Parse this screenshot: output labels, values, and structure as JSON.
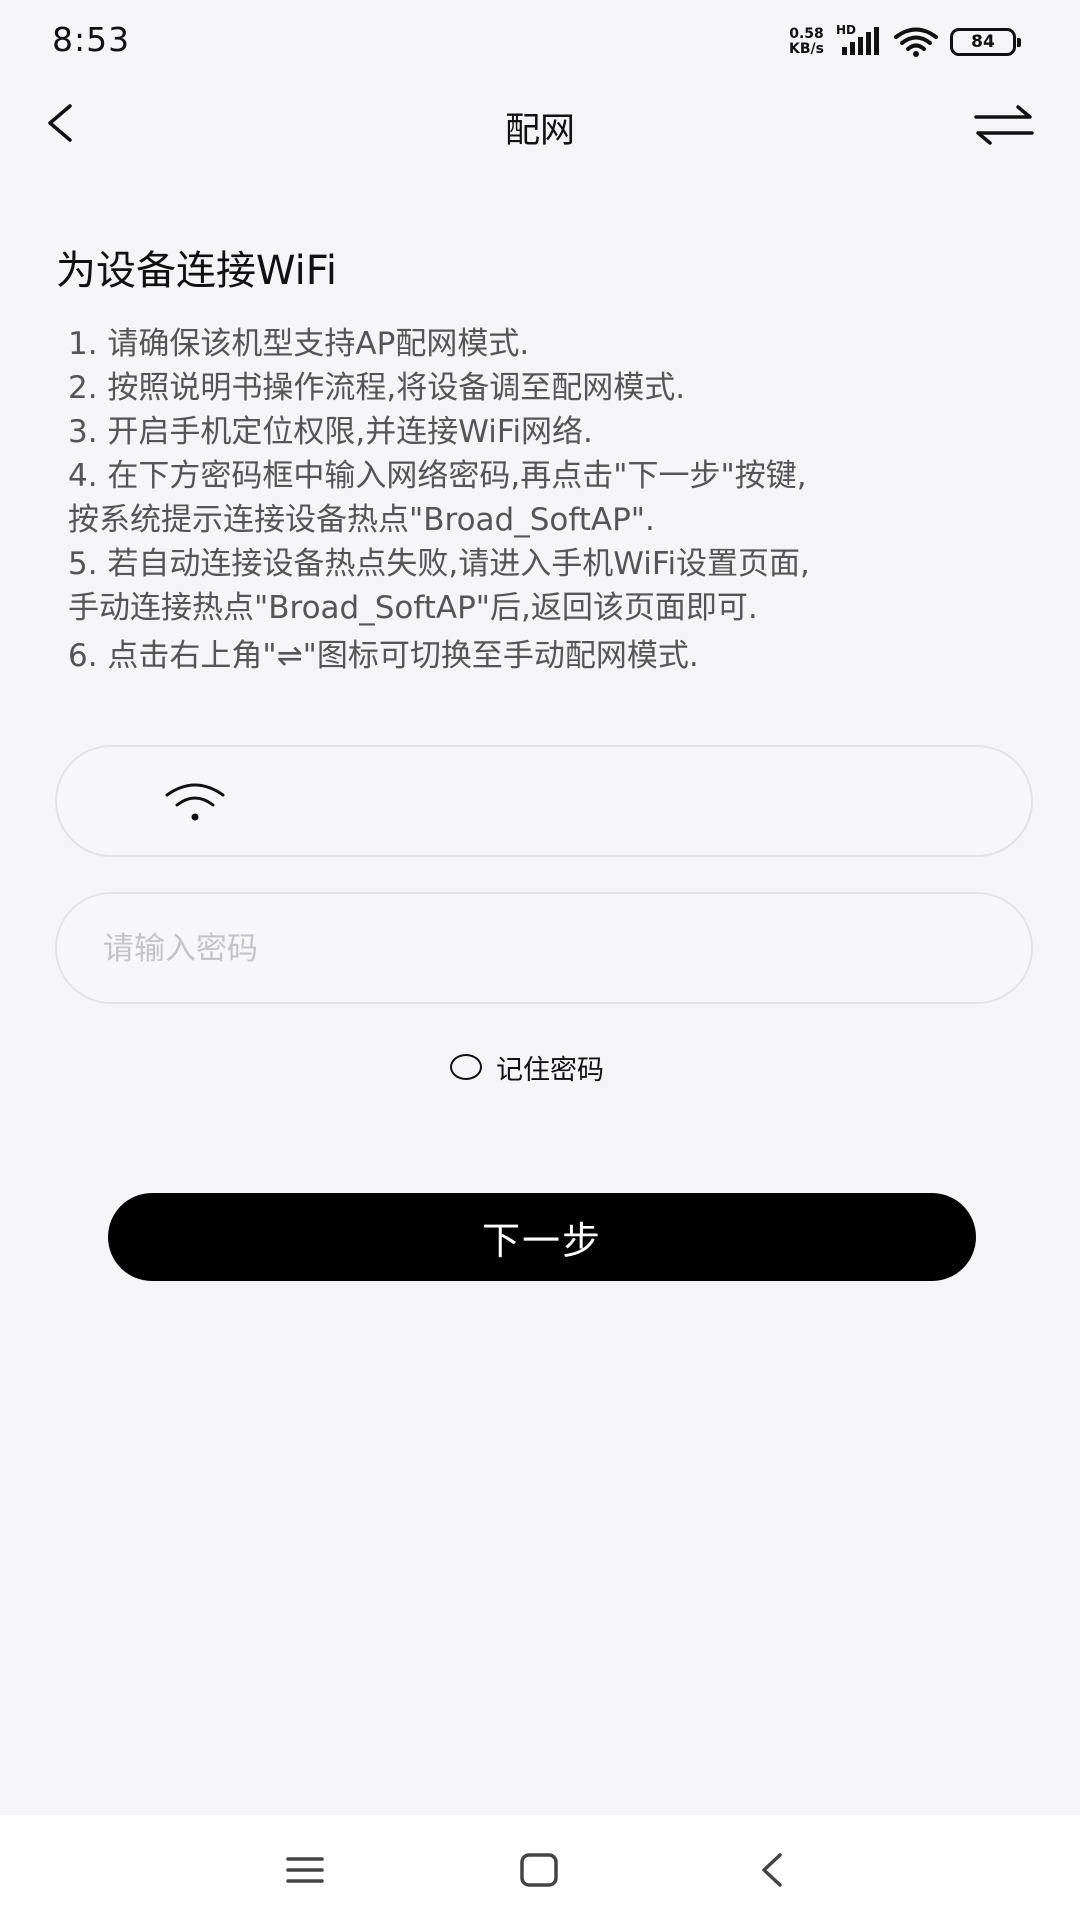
{
  "status_bar": {
    "time": "8:53",
    "net_speed_value": "0.58",
    "net_speed_unit": "KB/s",
    "network_type": "HD",
    "battery_level": "84",
    "icons": [
      "signal-icon",
      "wifi-icon",
      "battery-icon"
    ]
  },
  "nav": {
    "title": "配网",
    "back_icon": "chevron-left-icon",
    "switch_icon": "swap-arrows-icon"
  },
  "content": {
    "title": "为设备连接WiFi",
    "instructions": [
      "1. 请确保该机型支持AP配网模式.",
      "2. 按照说明书操作流程,将设备调至配网模式.",
      "3. 开启手机定位权限,并连接WiFi网络.",
      "4. 在下方密码框中输入网络密码,再点击\"下一步\"按键,",
      "按系统提示连接设备热点\"Broad_SoftAP\".",
      "5. 若自动连接设备热点失败,请进入手机WiFi设置页面,",
      "手动连接热点\"Broad_SoftAP\"后,返回该页面即可.",
      "6. 点击右上角\"⇌\"图标可切换至手动配网模式."
    ]
  },
  "form": {
    "wifi_icon": "wifi-icon",
    "wifi_name_value": "",
    "password_placeholder": "请输入密码",
    "password_value": "",
    "remember_label": "记住密码",
    "remember_checked": false,
    "next_label": "下一步"
  },
  "system_nav": {
    "icons": [
      "menu-icon",
      "home-icon",
      "back-icon"
    ]
  }
}
